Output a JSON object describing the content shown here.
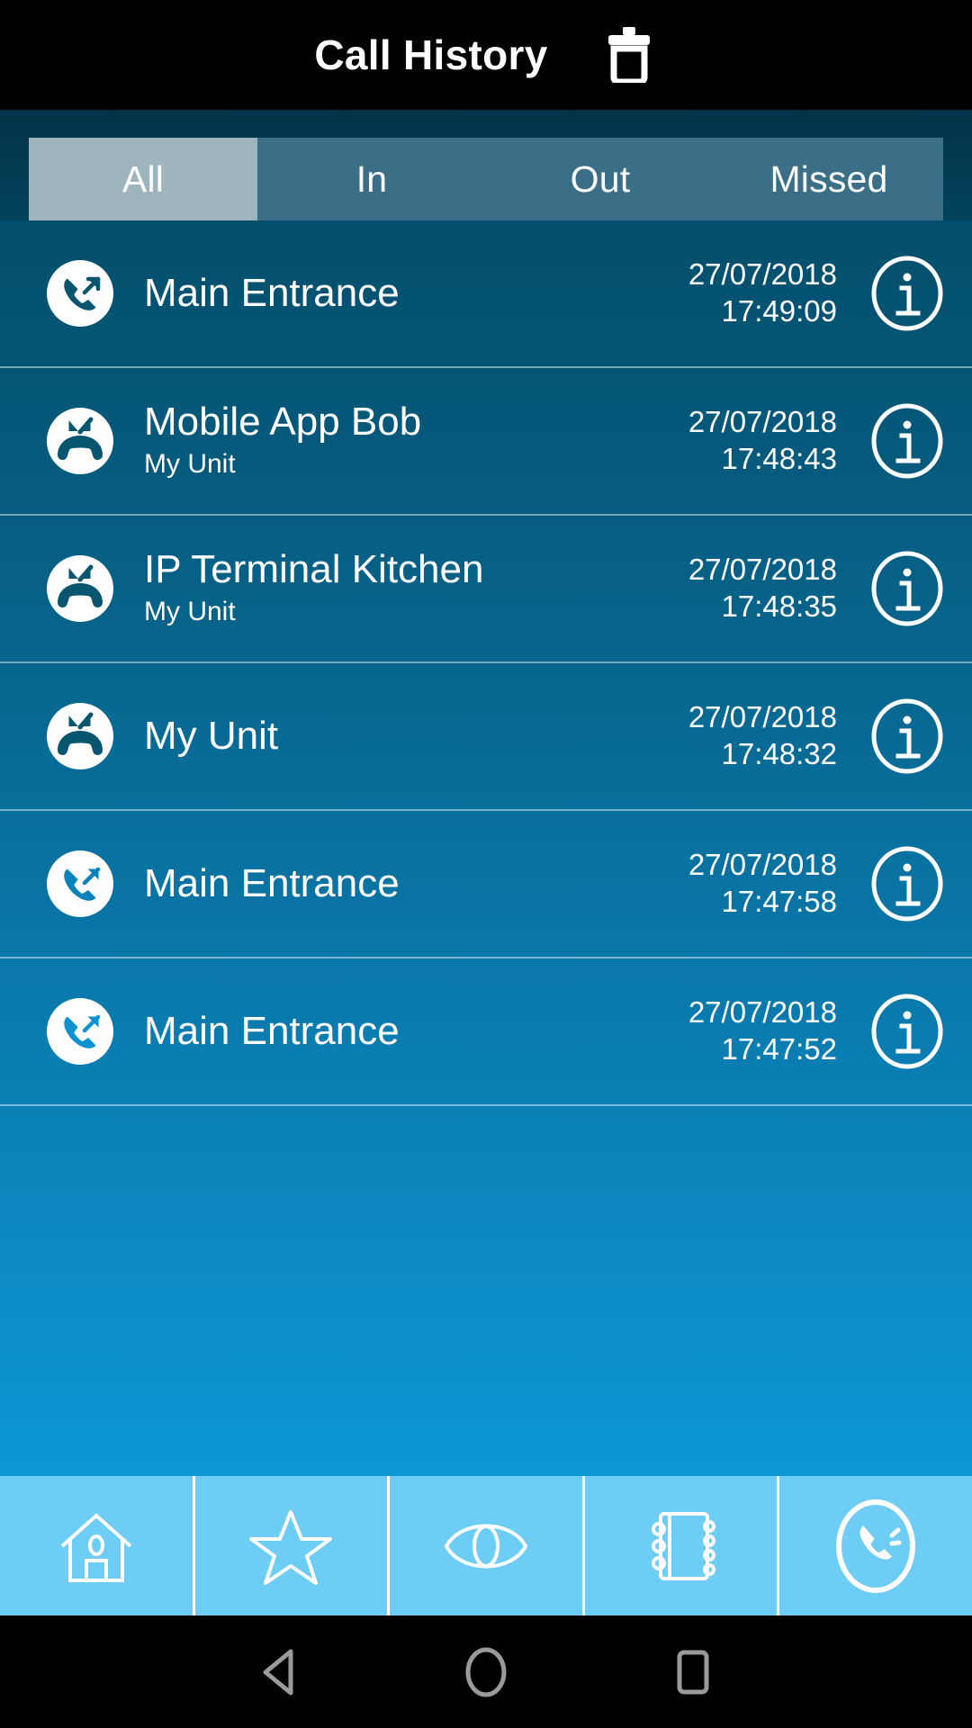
{
  "header": {
    "title": "Call History",
    "delete_icon": "trash-icon"
  },
  "tabs": {
    "items": [
      {
        "label": "All",
        "selected": true
      },
      {
        "label": "In",
        "selected": false
      },
      {
        "label": "Out",
        "selected": false
      },
      {
        "label": "Missed",
        "selected": false
      }
    ]
  },
  "calls": [
    {
      "name": "Main Entrance",
      "unit": "",
      "date": "27/07/2018",
      "time": "17:49:09",
      "direction": "outgoing",
      "icon": "call-outgoing-icon",
      "info_icon": "info-icon"
    },
    {
      "name": "Mobile App Bob",
      "unit": "My Unit",
      "date": "27/07/2018",
      "time": "17:48:43",
      "direction": "incoming",
      "icon": "call-incoming-icon",
      "info_icon": "info-icon"
    },
    {
      "name": "IP Terminal Kitchen",
      "unit": "My Unit",
      "date": "27/07/2018",
      "time": "17:48:35",
      "direction": "incoming",
      "icon": "call-incoming-icon",
      "info_icon": "info-icon"
    },
    {
      "name": "My Unit",
      "unit": "",
      "date": "27/07/2018",
      "time": "17:48:32",
      "direction": "incoming",
      "icon": "call-incoming-icon",
      "info_icon": "info-icon"
    },
    {
      "name": "Main Entrance",
      "unit": "",
      "date": "27/07/2018",
      "time": "17:47:58",
      "direction": "outgoing",
      "icon": "call-outgoing-icon",
      "info_icon": "info-icon"
    },
    {
      "name": "Main Entrance",
      "unit": "",
      "date": "27/07/2018",
      "time": "17:47:52",
      "direction": "outgoing",
      "icon": "call-outgoing-icon",
      "info_icon": "info-icon"
    }
  ],
  "bottom_nav": {
    "items": [
      {
        "icon": "home-icon"
      },
      {
        "icon": "star-icon"
      },
      {
        "icon": "eye-icon"
      },
      {
        "icon": "address-book-icon"
      },
      {
        "icon": "phone-circle-icon"
      }
    ]
  },
  "system_bar": {
    "items": [
      {
        "icon": "back-triangle-icon"
      },
      {
        "icon": "home-circle-icon"
      },
      {
        "icon": "recents-square-icon"
      }
    ]
  },
  "colors": {
    "appbar_bg": "#000000",
    "tab_bg": "#3A6F87",
    "tab_selected_bg": "#9FB5BE",
    "list_gradient_top": "#02455D",
    "list_gradient_bottom": "#12A5E6",
    "bottom_nav_bg": "#6ECDF4",
    "text": "#FFFFFF"
  }
}
